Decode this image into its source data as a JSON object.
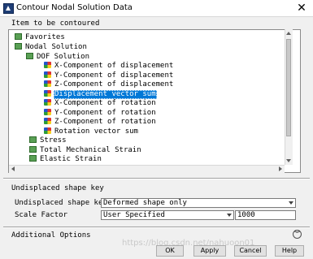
{
  "window": {
    "title": "Contour Nodal Solution Data",
    "close_glyph": "✕"
  },
  "tree": {
    "heading": "Item to be contoured",
    "items": [
      {
        "label": "Favorites",
        "icon": "folder-icon"
      },
      {
        "label": "Nodal Solution",
        "icon": "folder-icon"
      },
      {
        "label": "DOF Solution",
        "icon": "folder-icon"
      },
      {
        "label": "X-Component of displacement",
        "icon": "leaf-icon"
      },
      {
        "label": "Y-Component of displacement",
        "icon": "leaf-icon"
      },
      {
        "label": "Z-Component of displacement",
        "icon": "leaf-icon"
      },
      {
        "label": "Displacement vector sum",
        "icon": "leaf-icon",
        "selected": true
      },
      {
        "label": "X-Component of rotation",
        "icon": "leaf-icon"
      },
      {
        "label": "Y-Component of rotation",
        "icon": "leaf-icon"
      },
      {
        "label": "Z-Component of rotation",
        "icon": "leaf-icon"
      },
      {
        "label": "Rotation vector sum",
        "icon": "leaf-icon"
      },
      {
        "label": "Stress",
        "icon": "folder-icon"
      },
      {
        "label": "Total Mechanical Strain",
        "icon": "folder-icon"
      },
      {
        "label": "Elastic Strain",
        "icon": "folder-icon"
      }
    ]
  },
  "undisplaced": {
    "section_title": "Undisplaced shape key",
    "shape_key_label": "Undisplaced shape key",
    "shape_key_value": "Deformed shape only",
    "scale_factor_label": "Scale Factor",
    "scale_factor_mode": "User Specified",
    "scale_factor_value": "1000"
  },
  "additional": {
    "label": "Additional Options",
    "expand_glyph": "︾"
  },
  "buttons": {
    "ok": "OK",
    "apply": "Apply",
    "cancel": "Cancel",
    "help": "Help"
  },
  "watermark": "https://blog.csdn.net/nahuoon01"
}
